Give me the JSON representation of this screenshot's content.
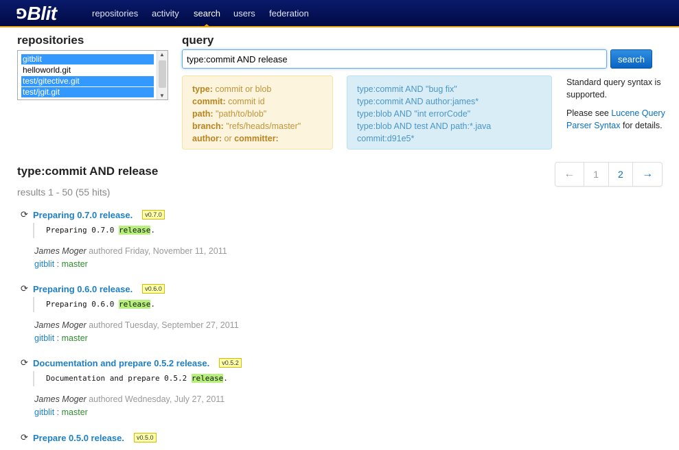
{
  "brand": {
    "mark": "⅁",
    "name": "Blit"
  },
  "nav": [
    {
      "label": "repositories"
    },
    {
      "label": "activity"
    },
    {
      "label": "search"
    },
    {
      "label": "users"
    },
    {
      "label": "federation"
    }
  ],
  "repositories": {
    "heading": "repositories",
    "items": [
      {
        "label": "gitblit",
        "selected": true
      },
      {
        "label": "helloworld.git",
        "selected": false
      },
      {
        "label": "test/gitective.git",
        "selected": true
      },
      {
        "label": "test/jgit.git",
        "selected": true
      }
    ]
  },
  "query": {
    "heading": "query",
    "value": "type:commit AND release",
    "button": "search"
  },
  "fields_help": [
    {
      "key": "type:",
      "rest": " commit or blob"
    },
    {
      "key": "commit:",
      "rest": " commit id"
    },
    {
      "key": "path:",
      "rest": " \"path/to/blob\""
    },
    {
      "key": "branch:",
      "rest": " \"refs/heads/master\""
    },
    {
      "key": "author:",
      "rest": " or ",
      "key2": "committer:"
    }
  ],
  "examples": [
    "type:commit AND \"bug fix\"",
    "type:commit AND author:james*",
    "type:blob AND \"int errorCode\"",
    "type:blob AND test AND path:*.java",
    "commit:d91e5*"
  ],
  "side_note": {
    "line1": "Standard query syntax is supported.",
    "line2_pre": "Please see ",
    "line2_link": "Lucene Query Parser Syntax",
    "line2_post": " for details."
  },
  "results": {
    "title": "type:commit AND release",
    "count": "results 1 - 50 (55 hits)",
    "pager": {
      "prev": "←",
      "pages": [
        "1",
        "2"
      ],
      "next": "→"
    },
    "items": [
      {
        "title": "Preparing 0.7.0 release.",
        "tag": "v0.7.0",
        "msg_pre": "Preparing 0.7.0 ",
        "msg_hl": "release",
        "msg_post": ".",
        "author": "James Moger",
        "authored": " authored Friday, November 11, 2011",
        "repo": "gitblit",
        "sep": " : ",
        "branch": "master"
      },
      {
        "title": "Preparing 0.6.0 release.",
        "tag": "v0.6.0",
        "msg_pre": "Preparing 0.6.0 ",
        "msg_hl": "release",
        "msg_post": ".",
        "author": "James Moger",
        "authored": " authored Tuesday, September 27, 2011",
        "repo": "gitblit",
        "sep": " : ",
        "branch": "master"
      },
      {
        "title": "Documentation and prepare 0.5.2 release.",
        "tag": "v0.5.2",
        "msg_pre": "Documentation and prepare 0.5.2 ",
        "msg_hl": "release",
        "msg_post": ".",
        "author": "James Moger",
        "authored": " authored Wednesday, July 27, 2011",
        "repo": "gitblit",
        "sep": " : ",
        "branch": "master"
      },
      {
        "title": "Prepare 0.5.0 release.",
        "tag": "v0.5.0"
      }
    ]
  },
  "colors": {
    "nav_bg": "#0a1a6b",
    "accent": "#e8a317",
    "link": "#1d7fc4",
    "highlight": "#b6f07a",
    "branch": "#2f8b2f"
  },
  "icons": {
    "commit": "refresh-icon"
  }
}
